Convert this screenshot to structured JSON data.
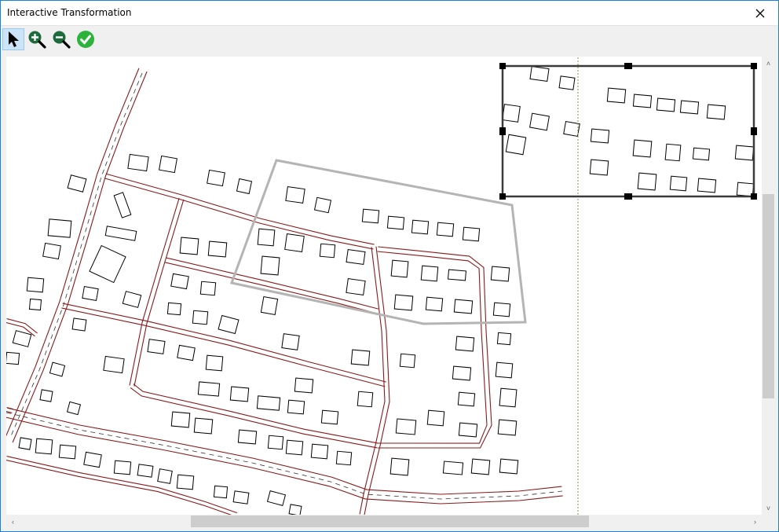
{
  "window": {
    "title": "Interactive Transformation"
  },
  "toolbar": {
    "tools": [
      {
        "name": "select",
        "icon": "arrow-pointer-icon",
        "active": true
      },
      {
        "name": "zoom-in",
        "icon": "zoom-in-icon",
        "active": false
      },
      {
        "name": "zoom-out",
        "icon": "zoom-out-icon",
        "active": false
      },
      {
        "name": "accept",
        "icon": "checkmark-icon",
        "active": false
      }
    ]
  },
  "colors": {
    "road": "#8b1a1a",
    "building": "#000000",
    "selection_polygon": "#b4b4b4",
    "frame": "#3a3a3a",
    "accept": "#2db23c",
    "zoom_icon": "#1d6b3a"
  },
  "scrollbars": {
    "horizontal": {
      "left_arrow": "‹",
      "right_arrow": "›"
    },
    "vertical": {
      "up_arrow": "˄",
      "down_arrow": "˅"
    }
  }
}
